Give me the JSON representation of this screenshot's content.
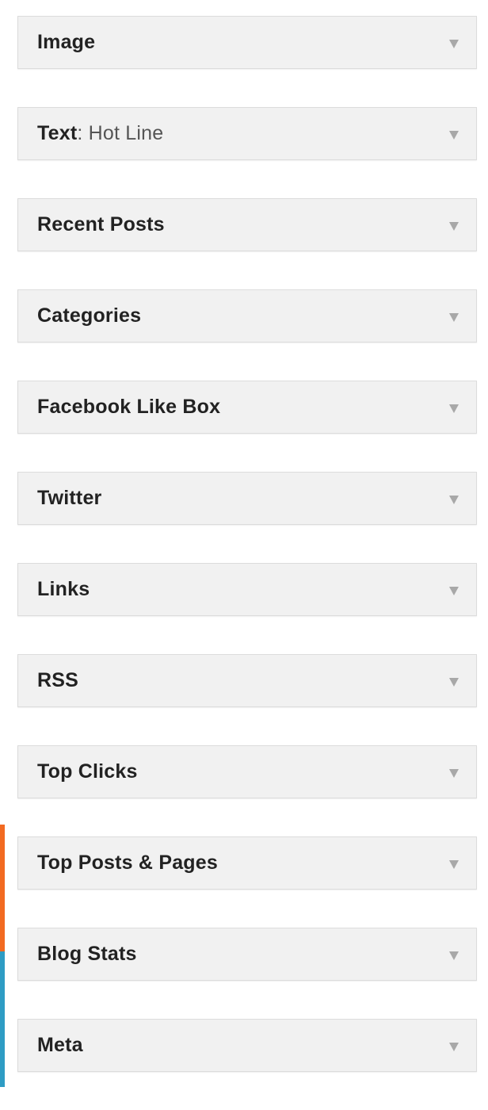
{
  "widgets": [
    {
      "title": "Image",
      "subtitle": ""
    },
    {
      "title": "Text",
      "subtitle": ": Hot Line"
    },
    {
      "title": "Recent Posts",
      "subtitle": ""
    },
    {
      "title": "Categories",
      "subtitle": ""
    },
    {
      "title": "Facebook Like Box",
      "subtitle": ""
    },
    {
      "title": "Twitter",
      "subtitle": ""
    },
    {
      "title": "Links",
      "subtitle": ""
    },
    {
      "title": "RSS",
      "subtitle": ""
    },
    {
      "title": "Top Clicks",
      "subtitle": ""
    },
    {
      "title": "Top Posts & Pages",
      "subtitle": ""
    },
    {
      "title": "Blog Stats",
      "subtitle": ""
    },
    {
      "title": "Meta",
      "subtitle": ""
    }
  ],
  "colors": {
    "widget_bg": "#f1f1f1",
    "accent_orange": "#f26a21",
    "accent_blue": "#2e9cc4"
  },
  "icons": {
    "toggle": "arrow-down-icon"
  }
}
